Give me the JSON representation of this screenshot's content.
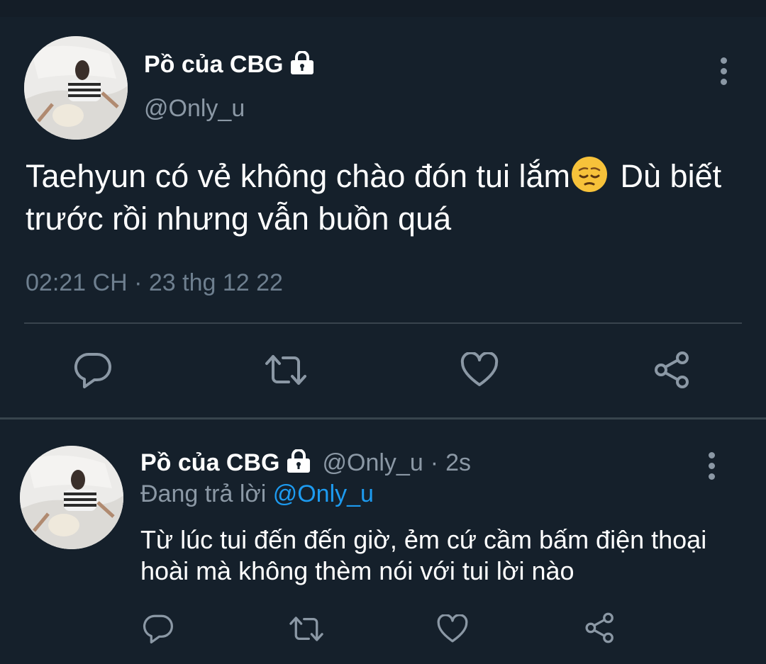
{
  "tweet": {
    "author_name": "Pồ của CBG",
    "author_handle": "@Only_u",
    "text_main": "Taehyun có vẻ không chào đón tui lắm",
    "text_after_emoji": " Dù biết trước rồi nhưng vẫn buồn quá",
    "emoji": "pensive-face",
    "timestamp": "02:21 CH · 23 thg 12 22",
    "actions": [
      "reply-icon",
      "retweet-icon",
      "like-icon",
      "share-icon"
    ]
  },
  "reply": {
    "author_name": "Pồ của CBG",
    "author_handle": "@Only_u",
    "separator": "·",
    "time": "2s",
    "replying_label": "Đang trả lời",
    "replying_to": "@Only_u",
    "text": "Từ lúc tui đến đến giờ, ẻm cứ cầm bấm điện thoại hoài mà không thèm nói với tui lời nào",
    "actions": [
      "reply-icon",
      "retweet-icon",
      "like-icon",
      "share-icon"
    ]
  },
  "colors": {
    "background": "#15202b",
    "text": "#ffffff",
    "secondary_text": "#8b98a5",
    "timestamp": "#6e7f8f",
    "link": "#1d9bf0",
    "divider": "#38444d"
  }
}
